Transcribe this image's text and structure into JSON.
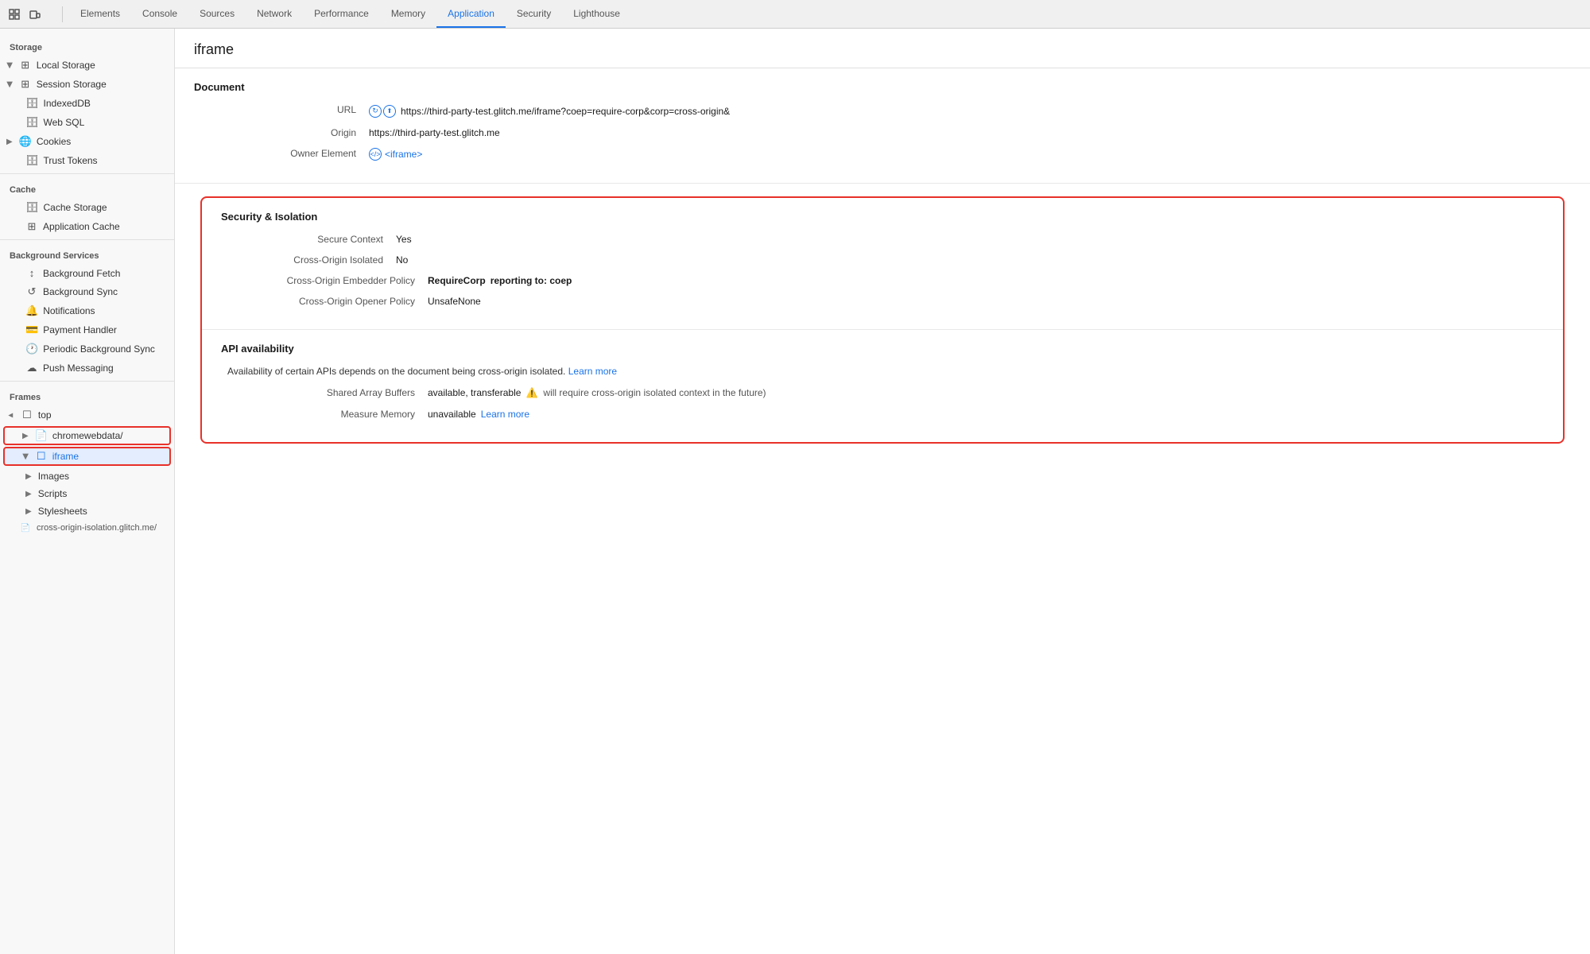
{
  "topbar": {
    "tabs": [
      {
        "label": "Elements",
        "active": false
      },
      {
        "label": "Console",
        "active": false
      },
      {
        "label": "Sources",
        "active": false
      },
      {
        "label": "Network",
        "active": false
      },
      {
        "label": "Performance",
        "active": false
      },
      {
        "label": "Memory",
        "active": false
      },
      {
        "label": "Application",
        "active": true
      },
      {
        "label": "Security",
        "active": false
      },
      {
        "label": "Lighthouse",
        "active": false
      }
    ]
  },
  "sidebar": {
    "storage_label": "Storage",
    "cache_label": "Cache",
    "background_services_label": "Background Services",
    "frames_label": "Frames",
    "items": {
      "local_storage": "Local Storage",
      "session_storage": "Session Storage",
      "indexed_db": "IndexedDB",
      "web_sql": "Web SQL",
      "cookies": "Cookies",
      "trust_tokens": "Trust Tokens",
      "cache_storage": "Cache Storage",
      "application_cache": "Application Cache",
      "background_fetch": "Background Fetch",
      "background_sync": "Background Sync",
      "notifications": "Notifications",
      "payment_handler": "Payment Handler",
      "periodic_background_sync": "Periodic Background Sync",
      "push_messaging": "Push Messaging",
      "top": "top",
      "chromewebdata": "chromewebdata/",
      "iframe": "iframe",
      "images": "Images",
      "scripts": "Scripts",
      "stylesheets": "Stylesheets",
      "cross_origin": "cross-origin-isolation.glitch.me/"
    }
  },
  "content": {
    "title": "iframe",
    "document_section": "Document",
    "url_label": "URL",
    "url_value": "https://third-party-test.glitch.me/iframe?coep=require-corp&corp=cross-origin&",
    "origin_label": "Origin",
    "origin_value": "https://third-party-test.glitch.me",
    "owner_element_label": "Owner Element",
    "owner_element_value": "<iframe>",
    "security_section": "Security & Isolation",
    "secure_context_label": "Secure Context",
    "secure_context_value": "Yes",
    "cross_origin_isolated_label": "Cross-Origin Isolated",
    "cross_origin_isolated_value": "No",
    "coep_label": "Cross-Origin Embedder Policy",
    "coep_value": "RequireCorp",
    "coep_reporting": "reporting to:",
    "coep_reporting_value": "coep",
    "coop_label": "Cross-Origin Opener Policy",
    "coop_value": "UnsafeNone",
    "api_section": "API availability",
    "api_note": "Availability of certain APIs depends on the document being cross-origin isolated.",
    "api_learn_more": "Learn more",
    "shared_array_label": "Shared Array Buffers",
    "shared_array_value": "available, transferable",
    "shared_array_warning": "⚠",
    "shared_array_note": "will require cross-origin isolated context in the future)",
    "measure_memory_label": "Measure Memory",
    "measure_memory_value": "unavailable",
    "measure_memory_learn_more": "Learn more"
  }
}
